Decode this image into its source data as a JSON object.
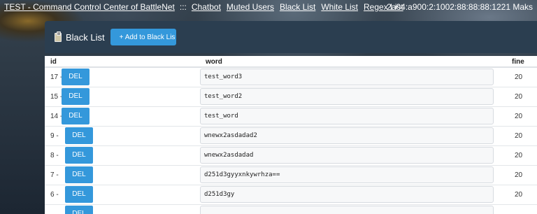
{
  "topbar": {
    "title": "TEST - Command Control Center of BattleNet",
    "separator": ":::",
    "nav": [
      "Chatbot",
      "Muted Users",
      "Black List",
      "White List",
      "Regex List"
    ],
    "ip": "2a04:a900:2:1002:88:88:88:1221 Maks"
  },
  "panel": {
    "icon": "clipboard-icon",
    "title": "Black List",
    "add_button": "+ Add to Black Lis"
  },
  "table": {
    "columns": [
      "id",
      "word",
      "fine"
    ],
    "delete_label": "DEL",
    "rows": [
      {
        "id": "17 -",
        "word": "test_word3",
        "fine": "20"
      },
      {
        "id": "15 -",
        "word": "test_word2",
        "fine": "20"
      },
      {
        "id": "14 -",
        "word": "test_word",
        "fine": "20"
      },
      {
        "id": "9 -",
        "word": "wnewx2asdadad2",
        "fine": "20"
      },
      {
        "id": "8 -",
        "word": "wnewx2asdadad",
        "fine": "20"
      },
      {
        "id": "7 -",
        "word": "d251d3gyyxnkywrhza==",
        "fine": "20"
      },
      {
        "id": "6 -",
        "word": "d251d3gy",
        "fine": "20"
      },
      {
        "id": "",
        "word": "",
        "fine": ""
      }
    ]
  }
}
